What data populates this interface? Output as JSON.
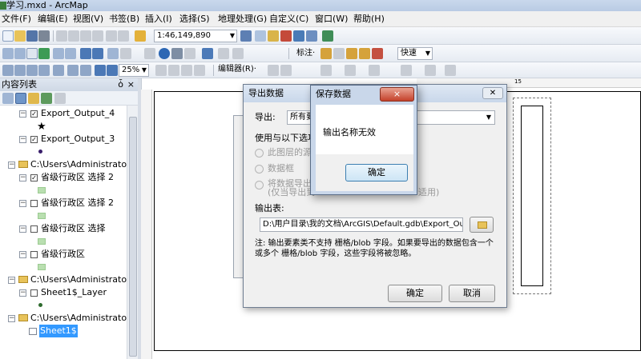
{
  "window": {
    "title": "学习.mxd - ArcMap"
  },
  "menu": [
    "文件(F)",
    "编辑(E)",
    "视图(V)",
    "书签(B)",
    "插入(I)",
    "选择(S)",
    "地理处理(G)",
    "自定义(C)",
    "窗口(W)",
    "帮助(H)"
  ],
  "toolbar": {
    "scale": "1:46,149,890",
    "zoom": "25%",
    "editor_label": "编辑器(R)·",
    "label_label": "标注·",
    "speed": "快速"
  },
  "toc": {
    "title": "内容列表",
    "pin": "ȱ",
    "close": "×",
    "items": [
      {
        "label": "Export_Output_4",
        "checked": true
      },
      {
        "label": "Export_Output_3",
        "checked": true
      },
      {
        "label": "C:\\Users\\Administrator\\"
      },
      {
        "label": "省级行政区 选择 2",
        "checked": true
      },
      {
        "label": "省级行政区 选择 2",
        "checked": false
      },
      {
        "label": "省级行政区 选择",
        "checked": false
      },
      {
        "label": "省级行政区",
        "checked": false
      },
      {
        "label": "C:\\Users\\Administrator\\"
      },
      {
        "label": "Sheet1$_Layer",
        "checked": false
      },
      {
        "label": "C:\\Users\\Administrator\\"
      },
      {
        "label": "Sheet1$"
      }
    ]
  },
  "ruler": {
    "mark": "15"
  },
  "export_dialog": {
    "title": "导出数据",
    "export_label": "导出:",
    "export_value": "所有要",
    "use_label": "使用与以下选项",
    "opt1": "此图层的源",
    "opt2": "数据框",
    "opt3a": "将数据导出",
    "opt3b": "(仅当导出到",
    "opt3_tail": "适用)",
    "output_label": "输出表:",
    "output_path": "D:\\用户目录\\我的文档\\ArcGIS\\Default.gdb\\Export_Output",
    "note": "注: 输出要素类不支持 栅格/blob 字段。如果要导出的数据包含一个或多个 栅格/blob 字段，这些字段将被忽略。",
    "ok": "确定",
    "cancel": "取消"
  },
  "message_box": {
    "title": "保存数据",
    "close": "×",
    "text": "输出名称无效",
    "ok": "确定"
  }
}
